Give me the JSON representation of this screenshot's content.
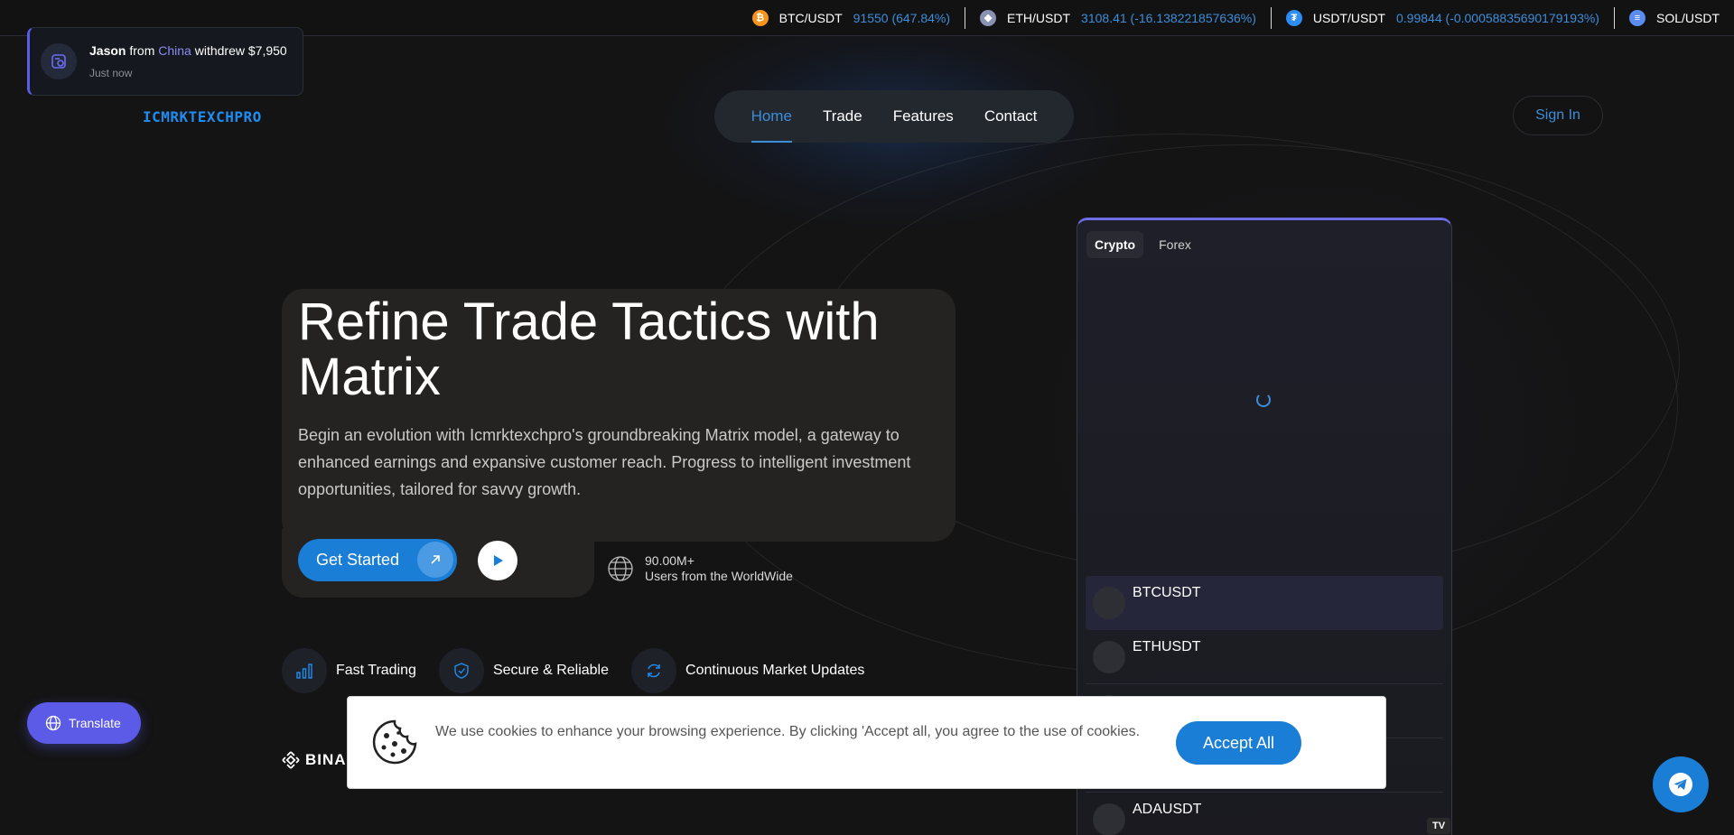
{
  "ticker": [
    {
      "pair": "BTC/USDT",
      "price": "91550 (647.84%)",
      "icon": "bitcoin-icon",
      "color": "#f7931a",
      "glyph": "₿"
    },
    {
      "pair": "ETH/USDT",
      "price": "3108.41 (-16.138221857636%)",
      "icon": "ethereum-icon",
      "color": "#8a92b2",
      "glyph": "◆"
    },
    {
      "pair": "USDT/USDT",
      "price": "0.99844 (-0.00058835690179193%)",
      "icon": "tether-icon",
      "color": "#2f8cf0",
      "glyph": "₮"
    },
    {
      "pair": "SOL/USDT",
      "price": "",
      "icon": "solana-icon",
      "color": "#5b8cf0",
      "glyph": "≡"
    }
  ],
  "notification": {
    "name": "Jason",
    "from": "from",
    "country": "China",
    "action": "withdrew $7,950",
    "time": "Just now"
  },
  "logo": {
    "text": "ICMRKTEXCHPRO"
  },
  "nav": {
    "items": [
      "Home",
      "Trade",
      "Features",
      "Contact"
    ],
    "active": "Home",
    "signin": "Sign In"
  },
  "hero": {
    "title": "Refine Trade Tactics with Matrix",
    "description": "Begin an evolution with Icmrktexchpro's groundbreaking Matrix model, a gateway to enhanced earnings and expansive customer reach. Progress to intelligent investment opportunities, tailored for savvy growth.",
    "cta": "Get Started",
    "users_count": "90.00M+",
    "users_label": "Users from the WorldWide"
  },
  "features": [
    "Fast Trading",
    "Secure & Reliable",
    "Continuous Market Updates"
  ],
  "partner": {
    "text": "BINA"
  },
  "market": {
    "tabs": [
      "Crypto",
      "Forex"
    ],
    "active_tab": "Crypto",
    "rows": [
      "BTCUSDT",
      "ETHUSDT",
      "",
      "",
      "ADAUSDT"
    ],
    "badge": "TV"
  },
  "cookie": {
    "text": "We use cookies to enhance your browsing experience. By clicking 'Accept all, you agree to the use of cookies.",
    "accept": "Accept All"
  },
  "translate": {
    "label": "Translate"
  },
  "colors": {
    "accent": "#1b7ed6",
    "link": "#3d8ddb",
    "purple": "#5b5be8",
    "background": "#141414"
  }
}
